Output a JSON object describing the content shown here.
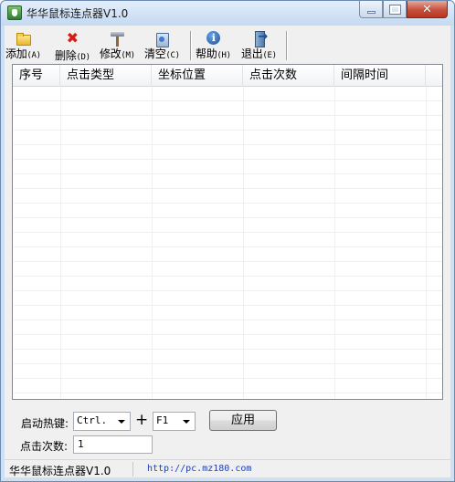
{
  "window": {
    "title": "华华鼠标连点器V1.0",
    "close_glyph": "✕"
  },
  "toolbar": {
    "items": [
      {
        "label": "添加",
        "key": "(A)",
        "icon": "folder-icon"
      },
      {
        "label": "删除",
        "key": "(D)",
        "icon": "delete-x-icon"
      },
      {
        "label": "修改",
        "key": "(M)",
        "icon": "hammer-icon"
      },
      {
        "label": "清空",
        "key": "(C)",
        "icon": "clear-icon"
      },
      {
        "label": "帮助",
        "key": "(H)",
        "icon": "help-icon"
      },
      {
        "label": "退出",
        "key": "(E)",
        "icon": "exit-icon"
      }
    ]
  },
  "table": {
    "columns": [
      "序号",
      "点击类型",
      "坐标位置",
      "点击次数",
      "间隔时间"
    ],
    "rows": []
  },
  "hotkey": {
    "label": "启动热键:",
    "modifier_value": "Ctrl.",
    "plus": "+",
    "key_value": "F1",
    "apply_label": "应用"
  },
  "clicks": {
    "label": "点击次数:",
    "value": "1"
  },
  "status": {
    "app_name": "华华鼠标连点器V1.0",
    "url": "http://pc.mz180.com"
  },
  "colors": {
    "status_url": "#1a3fc0",
    "close_button": "#c7503b"
  }
}
